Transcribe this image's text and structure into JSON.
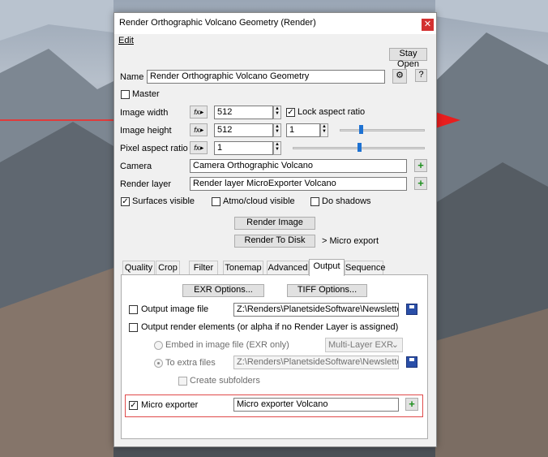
{
  "window": {
    "title": "Render Orthographic Volcano Geometry    (Render)",
    "close_glyph": "✕",
    "menu_edit": "Edit",
    "stay_open": "Stay Open",
    "help": "?"
  },
  "form": {
    "name_label": "Name",
    "name_value": "Render Orthographic Volcano Geometry",
    "master_label": "Master",
    "image_width_label": "Image width",
    "image_width_value": "512",
    "lock_aspect_label": "Lock aspect ratio",
    "image_height_label": "Image height",
    "image_height_value": "512",
    "height_ratio_value": "1",
    "pixel_aspect_label": "Pixel aspect ratio",
    "pixel_aspect_value": "1",
    "camera_label": "Camera",
    "camera_value": "Camera Orthographic Volcano",
    "render_layer_label": "Render layer",
    "render_layer_value": "Render layer MicroExporter Volcano",
    "surfaces_visible_label": "Surfaces visible",
    "atmo_cloud_label": "Atmo/cloud visible",
    "do_shadows_label": "Do shadows",
    "render_image_button": "Render Image",
    "render_to_disk_button": "Render To Disk",
    "render_to_disk_suffix": "> Micro export"
  },
  "checks": {
    "master": false,
    "lock_aspect": true,
    "surfaces_visible": true,
    "atmo_cloud": false,
    "do_shadows": false,
    "output_image_file": false,
    "output_render_elements": false,
    "create_subfolders": false,
    "micro_exporter": true
  },
  "tabs": [
    "Quality",
    "Crop",
    "Filter",
    "Tonemap",
    "Advanced",
    "Output",
    "Sequence"
  ],
  "active_tab": "Output",
  "output": {
    "exr_options_button": "EXR Options...",
    "tiff_options_button": "TIFF Options...",
    "output_image_file_label": "Output image file",
    "output_image_file_path": "Z:\\Renders\\PlanetsideSoftware\\Newsletters\\",
    "render_elements_label": "Output render elements (or alpha if no Render Layer is assigned)",
    "embed_label": "Embed in image file (EXR only)",
    "multilayer_value": "Multi-Layer EXR",
    "to_extra_files_label": "To extra files",
    "extra_files_path": "Z:\\Renders\\PlanetsideSoftware\\Newsletters\\",
    "create_subfolders_label": "Create subfolders",
    "micro_exporter_label": "Micro exporter",
    "micro_exporter_value": "Micro exporter Volcano"
  },
  "sliders": {
    "image_height_level": 0.25,
    "pixel_aspect_level": 0.5
  },
  "colors": {
    "accent_blue": "#1e72d2",
    "close_red": "#d33030",
    "highlight_red": "#e04a4a",
    "plus_green": "#1d8f1d"
  },
  "icons": {
    "gear": "gear-icon",
    "plus": "plus-icon",
    "floppy": "save-icon",
    "fx": "function-icon"
  }
}
